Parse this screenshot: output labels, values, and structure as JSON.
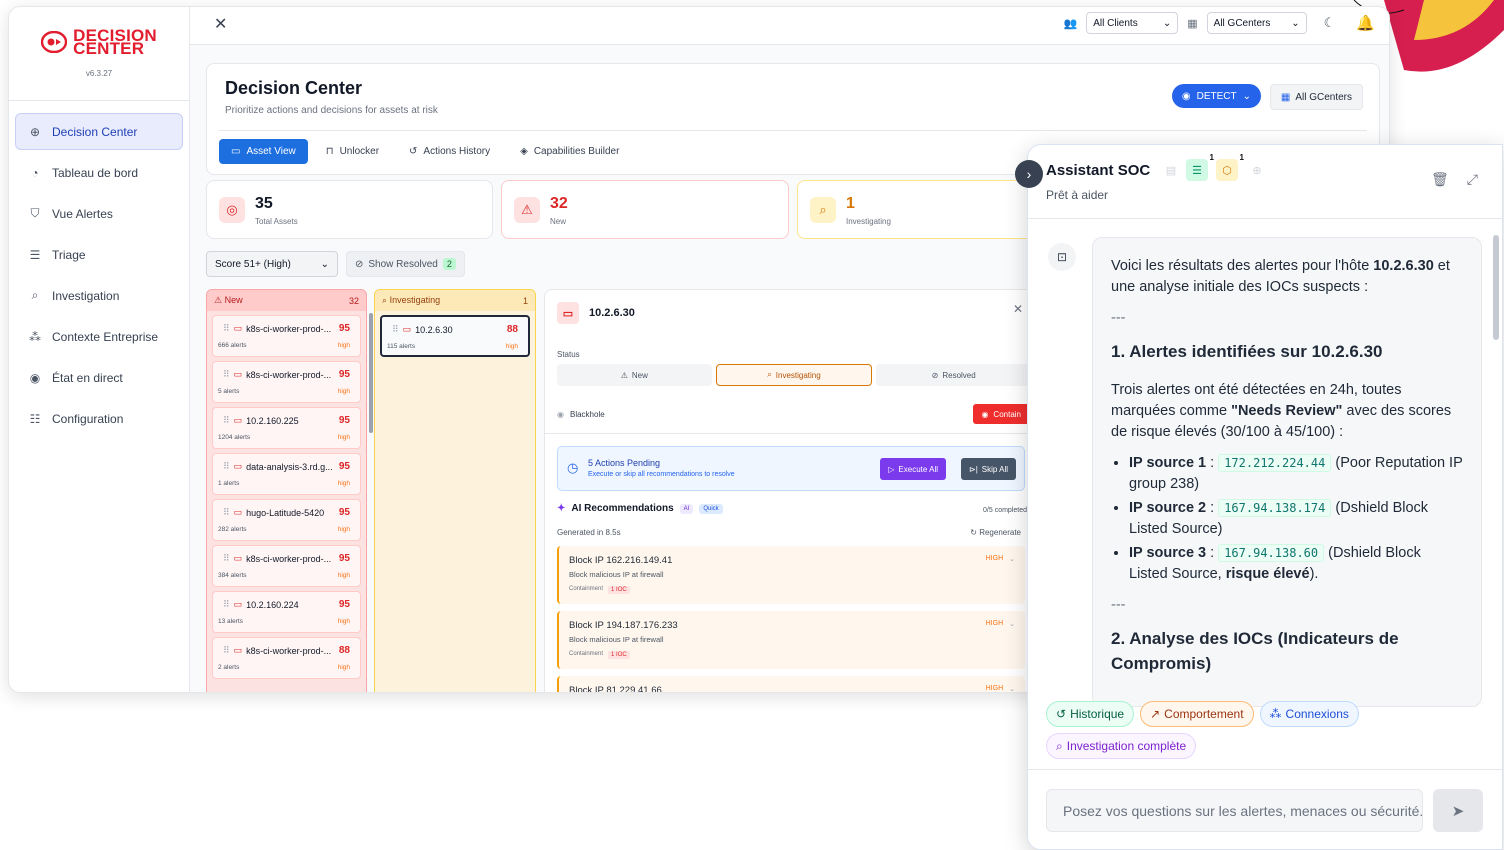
{
  "brand": {
    "line1": "DECISION",
    "line2": "CENTER",
    "version": "v6.3.27",
    "color": "#e11d2e"
  },
  "sidebar": {
    "items": [
      {
        "label": "Decision Center",
        "icon": "crosshair-icon",
        "active": true
      },
      {
        "label": "Tableau de bord",
        "icon": "pie-chart-icon"
      },
      {
        "label": "Vue Alertes",
        "icon": "shield-icon"
      },
      {
        "label": "Triage",
        "icon": "list-check-icon"
      },
      {
        "label": "Investigation",
        "icon": "search-icon"
      },
      {
        "label": "Contexte Entreprise",
        "icon": "network-icon"
      },
      {
        "label": "État en direct",
        "icon": "radio-icon"
      },
      {
        "label": "Configuration",
        "icon": "sliders-icon"
      }
    ]
  },
  "topbar": {
    "clients": "All Clients",
    "gcenters": "All GCenters"
  },
  "header": {
    "title": "Decision Center",
    "subtitle": "Prioritize actions and decisions for assets at risk",
    "detect": "DETECT",
    "all_gcenters": "All GCenters",
    "tabs": [
      "Asset View",
      "Unlocker",
      "Actions History",
      "Capabilities Builder"
    ]
  },
  "stats": [
    {
      "value": "35",
      "label": "Total Assets"
    },
    {
      "value": "32",
      "label": "New"
    },
    {
      "value": "1",
      "label": "Investigating"
    }
  ],
  "filters": {
    "score": "Score 51+ (High)",
    "show_resolved": "Show Resolved",
    "resolved_count": "2"
  },
  "columns": {
    "new": {
      "title": "New",
      "count": "32"
    },
    "investigating": {
      "title": "Investigating",
      "count": "1"
    }
  },
  "new_cards": [
    {
      "name": "k8s-ci-worker-prod-...",
      "score": "95",
      "alerts": "666 alerts",
      "level": "high"
    },
    {
      "name": "k8s-ci-worker-prod-...",
      "score": "95",
      "alerts": "5 alerts",
      "level": "high"
    },
    {
      "name": "10.2.160.225",
      "score": "95",
      "alerts": "1204 alerts",
      "level": "high"
    },
    {
      "name": "data-analysis-3.rd.g...",
      "score": "95",
      "alerts": "1 alerts",
      "level": "high"
    },
    {
      "name": "hugo-Latitude-5420",
      "score": "95",
      "alerts": "282 alerts",
      "level": "high"
    },
    {
      "name": "k8s-ci-worker-prod-...",
      "score": "95",
      "alerts": "384 alerts",
      "level": "high"
    },
    {
      "name": "10.2.160.224",
      "score": "95",
      "alerts": "13 alerts",
      "level": "high"
    },
    {
      "name": "k8s-ci-worker-prod-...",
      "score": "88",
      "alerts": "2 alerts",
      "level": "high"
    }
  ],
  "inv_cards": [
    {
      "name": "10.2.6.30",
      "score": "88",
      "alerts": "115 alerts",
      "level": "high"
    }
  ],
  "detail": {
    "host": "10.2.6.30",
    "status_label": "Status",
    "statuses": [
      "New",
      "Investigating",
      "Resolved"
    ],
    "blackhole": "Blackhole",
    "contain": "Contain",
    "pending_title": "5 Actions Pending",
    "pending_sub": "Execute or skip all recommendations to resolve",
    "execute_all": "Execute All",
    "skip_all": "Skip All",
    "ai_title": "AI Recommendations",
    "tag_ai": "AI",
    "tag_quick": "Quick",
    "completed": "0/5 completed",
    "generated": "Generated in 8.5s",
    "regenerate": "Regenerate",
    "recs": [
      {
        "title": "Block IP 162.216.149.41",
        "desc": "Block malicious IP at firewall",
        "cat": "Containment",
        "ioc": "1 IOC",
        "level": "HIGH"
      },
      {
        "title": "Block IP 194.187.176.233",
        "desc": "Block malicious IP at firewall",
        "cat": "Containment",
        "ioc": "1 IOC",
        "level": "HIGH"
      },
      {
        "title": "Block IP 81.229.41.66",
        "desc": "",
        "cat": "",
        "ioc": "",
        "level": "HIGH"
      }
    ]
  },
  "soc": {
    "title": "Assistant SOC",
    "subtitle": "Prêt à aider",
    "badge1": "1",
    "badge2": "1",
    "intro_a": "Voici les résultats des alertes pour l'hôte ",
    "intro_host": "10.2.6.30",
    "intro_b": " et une analyse initiale des IOCs suspects :",
    "dash": "---",
    "h1": "1. Alertes identifiées sur 10.2.6.30",
    "p1_a": "Trois alertes ont été détectées en 24h, toutes marquées comme ",
    "p1_b": "\"Needs Review\"",
    "p1_c": " avec des scores de risque élevés (30/100 à 45/100) :",
    "ips": [
      {
        "label": "IP source 1",
        "ip": "172.212.224.44",
        "note": "(Poor Reputation IP group 238)"
      },
      {
        "label": "IP source 2",
        "ip": "167.94.138.174",
        "note": "(Dshield Block Listed Source)"
      },
      {
        "label": "IP source 3",
        "ip": "167.94.138.60",
        "note": "(Dshield Block Listed Source, ",
        "strong": "risque élevé",
        "end": ")."
      }
    ],
    "h2": "2. Analyse des IOCs (Indicateurs de Compromis)",
    "chips": [
      "Historique",
      "Comportement",
      "Connexions",
      "Investigation complète"
    ],
    "placeholder": "Posez vos questions sur les alertes, menaces ou sécurité..."
  }
}
